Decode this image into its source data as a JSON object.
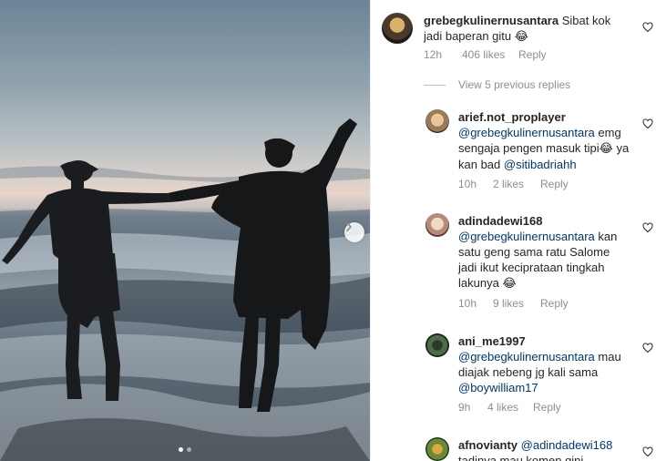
{
  "post": {
    "carousel_total": 2,
    "carousel_current": 1
  },
  "comments_panel": {
    "top_comment": {
      "username": "grebegkulinernusantara",
      "text": "Sibat kok jadi baperan gitu",
      "emoji": "😂",
      "time": "12h",
      "likes": "406 likes",
      "reply_label": "Reply"
    },
    "view_previous": "View 5 previous replies",
    "replies": [
      {
        "username": "arief.not_proplayer",
        "mention": "@grebegkulinernusantara",
        "text": "emg sengaja pengen masuk tipi",
        "emoji": "😂",
        "text2": "ya kan bad",
        "mention2": "@sitibadriahh",
        "time": "10h",
        "likes": "2 likes",
        "reply_label": "Reply"
      },
      {
        "username": "adindadewi168",
        "mention": "@grebegkulinernusantara",
        "text": "kan satu geng sama ratu Salome jadi ikut keciprataan tingkah lakunya",
        "emoji": "😂",
        "time": "10h",
        "likes": "9 likes",
        "reply_label": "Reply"
      },
      {
        "username": "ani_me1997",
        "mention": "@grebegkulinernusantara",
        "text": "mau diajak nebeng jg kali sama",
        "mention2": "@boywilliam17",
        "time": "9h",
        "likes": "4 likes",
        "reply_label": "Reply"
      },
      {
        "username": "afnovianty",
        "mention": "@adindadewi168",
        "text": "tadinya mau komen gini"
      }
    ]
  },
  "colors": {
    "text": "#262626",
    "muted": "#8e8e8e",
    "mention": "#00376b"
  }
}
